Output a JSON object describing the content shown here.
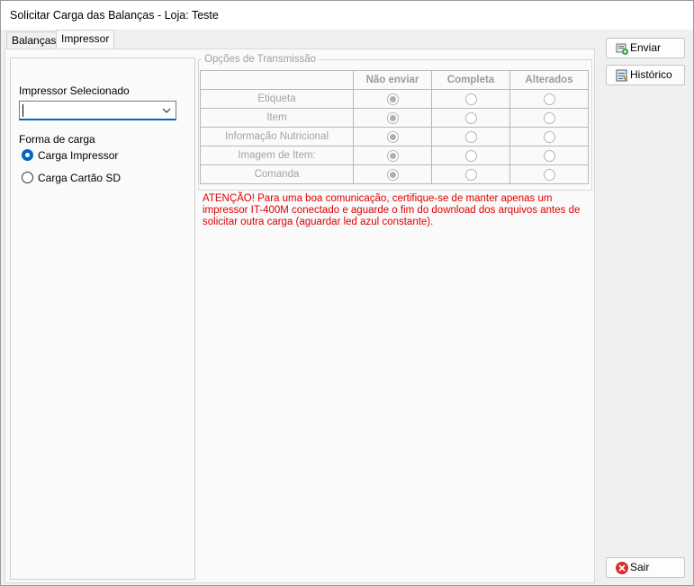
{
  "window": {
    "title": "Solicitar Carga das Balanças - Loja: Teste"
  },
  "tabs": [
    {
      "label": "Balanças",
      "active": false
    },
    {
      "label": "Impressor",
      "active": true
    }
  ],
  "left": {
    "printer_label": "Impressor Selecionado",
    "printer_value": "",
    "load_label": "Forma de carga",
    "options": [
      {
        "label": "Carga Impressor",
        "selected": true
      },
      {
        "label": "Carga Cartão SD",
        "selected": false
      }
    ]
  },
  "transmission": {
    "title": "Opções de Transmissão",
    "columns": [
      "Não enviar",
      "Completa",
      "Alterados"
    ],
    "rows": [
      "Etiqueta",
      "Item",
      "Informação Nutricional",
      "Imagem de Item:",
      "Comanda"
    ],
    "selected_column": "Não enviar"
  },
  "warning": "ATENÇÃO! Para uma boa comunicação, certifique-se de manter apenas um impressor IT-400M conectado e aguarde o fim do download dos arquivos antes de solicitar outra carga (aguardar led azul constante).",
  "buttons": {
    "send": "Enviar",
    "history": "Histórico",
    "exit": "Sair"
  },
  "colors": {
    "accent": "#0067c0",
    "warning": "#e00000"
  }
}
